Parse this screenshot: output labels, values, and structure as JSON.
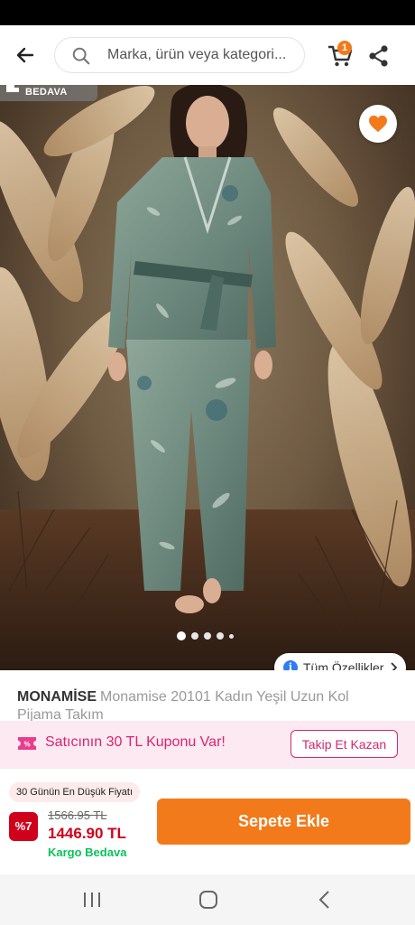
{
  "header": {
    "search_placeholder": "Marka, ürün veya kategori..."
  },
  "cart": {
    "count": "1"
  },
  "gallery": {
    "shipping_tag": "BEDAVA",
    "features_label": "Tüm Özellikler",
    "slide_count": 5,
    "active_slide": 1
  },
  "product": {
    "brand": "MONAMİSE",
    "title": "Monamise 20101 Kadın Yeşil Uzun Kol Pijama Takım"
  },
  "coupon": {
    "text": "Satıcının 30 TL Kuponu Var!",
    "button": "Takip Et Kazan"
  },
  "pricing": {
    "low_price_badge": "30 Günün En Düşük Fiyatı",
    "discount": "%7",
    "old_price": "1566.95 TL",
    "new_price": "1446.90 TL",
    "shipping": "Kargo Bedava",
    "add_to_cart": "Sepete Ekle"
  },
  "colors": {
    "accent": "#f27a1a",
    "coupon_pink": "#d6266e",
    "price_red": "#d0021b",
    "shipping_green": "#0bc15c"
  },
  "icons": {
    "back": "arrow-left-icon",
    "search": "search-icon",
    "cart": "cart-icon",
    "share": "share-icon",
    "favorite": "heart-icon",
    "info": "info-icon",
    "coupon": "coupon-icon"
  }
}
